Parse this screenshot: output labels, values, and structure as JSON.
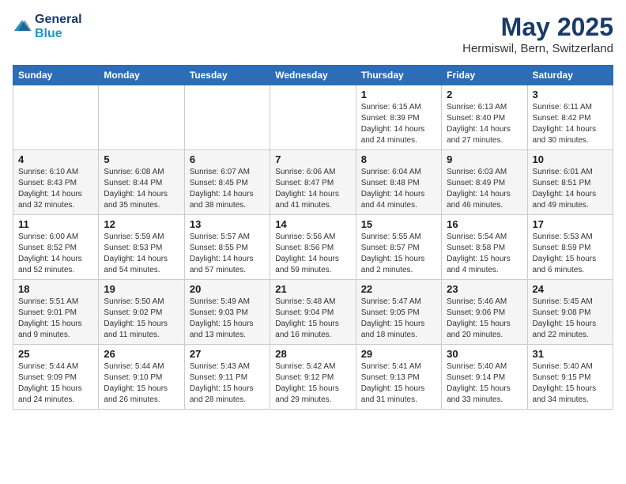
{
  "logo": {
    "line1": "General",
    "line2": "Blue"
  },
  "title": "May 2025",
  "subtitle": "Hermiswil, Bern, Switzerland",
  "days_of_week": [
    "Sunday",
    "Monday",
    "Tuesday",
    "Wednesday",
    "Thursday",
    "Friday",
    "Saturday"
  ],
  "weeks": [
    [
      {
        "num": "",
        "info": ""
      },
      {
        "num": "",
        "info": ""
      },
      {
        "num": "",
        "info": ""
      },
      {
        "num": "",
        "info": ""
      },
      {
        "num": "1",
        "info": "Sunrise: 6:15 AM\nSunset: 8:39 PM\nDaylight: 14 hours\nand 24 minutes."
      },
      {
        "num": "2",
        "info": "Sunrise: 6:13 AM\nSunset: 8:40 PM\nDaylight: 14 hours\nand 27 minutes."
      },
      {
        "num": "3",
        "info": "Sunrise: 6:11 AM\nSunset: 8:42 PM\nDaylight: 14 hours\nand 30 minutes."
      }
    ],
    [
      {
        "num": "4",
        "info": "Sunrise: 6:10 AM\nSunset: 8:43 PM\nDaylight: 14 hours\nand 32 minutes."
      },
      {
        "num": "5",
        "info": "Sunrise: 6:08 AM\nSunset: 8:44 PM\nDaylight: 14 hours\nand 35 minutes."
      },
      {
        "num": "6",
        "info": "Sunrise: 6:07 AM\nSunset: 8:45 PM\nDaylight: 14 hours\nand 38 minutes."
      },
      {
        "num": "7",
        "info": "Sunrise: 6:06 AM\nSunset: 8:47 PM\nDaylight: 14 hours\nand 41 minutes."
      },
      {
        "num": "8",
        "info": "Sunrise: 6:04 AM\nSunset: 8:48 PM\nDaylight: 14 hours\nand 44 minutes."
      },
      {
        "num": "9",
        "info": "Sunrise: 6:03 AM\nSunset: 8:49 PM\nDaylight: 14 hours\nand 46 minutes."
      },
      {
        "num": "10",
        "info": "Sunrise: 6:01 AM\nSunset: 8:51 PM\nDaylight: 14 hours\nand 49 minutes."
      }
    ],
    [
      {
        "num": "11",
        "info": "Sunrise: 6:00 AM\nSunset: 8:52 PM\nDaylight: 14 hours\nand 52 minutes."
      },
      {
        "num": "12",
        "info": "Sunrise: 5:59 AM\nSunset: 8:53 PM\nDaylight: 14 hours\nand 54 minutes."
      },
      {
        "num": "13",
        "info": "Sunrise: 5:57 AM\nSunset: 8:55 PM\nDaylight: 14 hours\nand 57 minutes."
      },
      {
        "num": "14",
        "info": "Sunrise: 5:56 AM\nSunset: 8:56 PM\nDaylight: 14 hours\nand 59 minutes."
      },
      {
        "num": "15",
        "info": "Sunrise: 5:55 AM\nSunset: 8:57 PM\nDaylight: 15 hours\nand 2 minutes."
      },
      {
        "num": "16",
        "info": "Sunrise: 5:54 AM\nSunset: 8:58 PM\nDaylight: 15 hours\nand 4 minutes."
      },
      {
        "num": "17",
        "info": "Sunrise: 5:53 AM\nSunset: 8:59 PM\nDaylight: 15 hours\nand 6 minutes."
      }
    ],
    [
      {
        "num": "18",
        "info": "Sunrise: 5:51 AM\nSunset: 9:01 PM\nDaylight: 15 hours\nand 9 minutes."
      },
      {
        "num": "19",
        "info": "Sunrise: 5:50 AM\nSunset: 9:02 PM\nDaylight: 15 hours\nand 11 minutes."
      },
      {
        "num": "20",
        "info": "Sunrise: 5:49 AM\nSunset: 9:03 PM\nDaylight: 15 hours\nand 13 minutes."
      },
      {
        "num": "21",
        "info": "Sunrise: 5:48 AM\nSunset: 9:04 PM\nDaylight: 15 hours\nand 16 minutes."
      },
      {
        "num": "22",
        "info": "Sunrise: 5:47 AM\nSunset: 9:05 PM\nDaylight: 15 hours\nand 18 minutes."
      },
      {
        "num": "23",
        "info": "Sunrise: 5:46 AM\nSunset: 9:06 PM\nDaylight: 15 hours\nand 20 minutes."
      },
      {
        "num": "24",
        "info": "Sunrise: 5:45 AM\nSunset: 9:08 PM\nDaylight: 15 hours\nand 22 minutes."
      }
    ],
    [
      {
        "num": "25",
        "info": "Sunrise: 5:44 AM\nSunset: 9:09 PM\nDaylight: 15 hours\nand 24 minutes."
      },
      {
        "num": "26",
        "info": "Sunrise: 5:44 AM\nSunset: 9:10 PM\nDaylight: 15 hours\nand 26 minutes."
      },
      {
        "num": "27",
        "info": "Sunrise: 5:43 AM\nSunset: 9:11 PM\nDaylight: 15 hours\nand 28 minutes."
      },
      {
        "num": "28",
        "info": "Sunrise: 5:42 AM\nSunset: 9:12 PM\nDaylight: 15 hours\nand 29 minutes."
      },
      {
        "num": "29",
        "info": "Sunrise: 5:41 AM\nSunset: 9:13 PM\nDaylight: 15 hours\nand 31 minutes."
      },
      {
        "num": "30",
        "info": "Sunrise: 5:40 AM\nSunset: 9:14 PM\nDaylight: 15 hours\nand 33 minutes."
      },
      {
        "num": "31",
        "info": "Sunrise: 5:40 AM\nSunset: 9:15 PM\nDaylight: 15 hours\nand 34 minutes."
      }
    ]
  ]
}
